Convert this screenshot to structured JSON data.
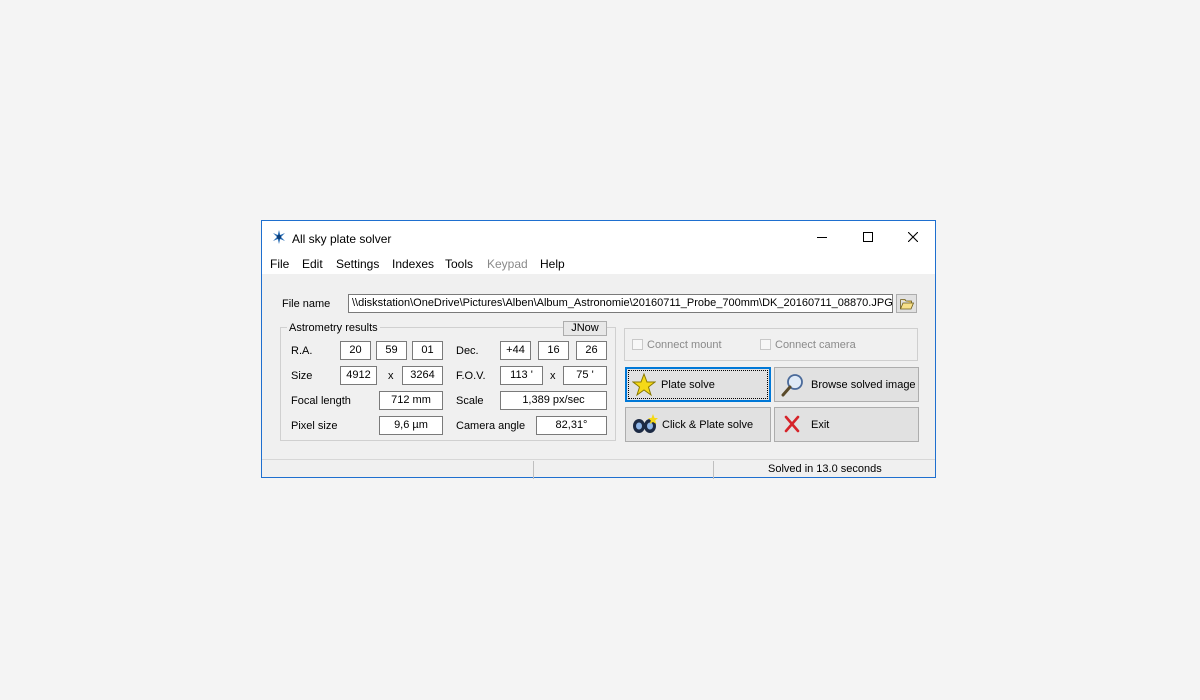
{
  "window": {
    "title": "All sky plate solver",
    "icon": "star-burst-icon"
  },
  "menu": [
    "File",
    "Edit",
    "Settings",
    "Indexes",
    "Tools",
    "Keypad",
    "Help"
  ],
  "file": {
    "label": "File name",
    "value": "\\\\diskstation\\OneDrive\\Pictures\\Alben\\Album_Astronomie\\20160711_Probe_700mm\\DK_20160711_08870.JPG",
    "browse_icon": "folder-open-icon"
  },
  "astrometry": {
    "title": "Astrometry results",
    "epoch_button": "JNow",
    "ra": {
      "label": "R.A.",
      "h": "20",
      "m": "59",
      "s": "01"
    },
    "dec": {
      "label": "Dec.",
      "d": "+44",
      "m": "16",
      "s": "26"
    },
    "size": {
      "label": "Size",
      "w": "4912",
      "x": "x",
      "h": "3264"
    },
    "fov": {
      "label": "F.O.V.",
      "w": "113 '",
      "x": "x",
      "h": "75 '"
    },
    "focal": {
      "label": "Focal length",
      "value": "712 mm"
    },
    "scale": {
      "label": "Scale",
      "value": "1,389  px/sec"
    },
    "pixel": {
      "label": "Pixel size",
      "value": "9,6 µm"
    },
    "angle": {
      "label": "Camera angle",
      "value": "82,31°"
    }
  },
  "connect": {
    "mount": "Connect mount",
    "camera": "Connect camera"
  },
  "buttons": {
    "plate_solve": "Plate solve",
    "browse": "Browse solved image",
    "click_plate_solve": "Click & Plate solve",
    "exit": "Exit"
  },
  "status": {
    "text": "Solved in 13.0 seconds"
  },
  "colors": {
    "accent": "#0078d7",
    "window_border": "#1e6fcf"
  }
}
